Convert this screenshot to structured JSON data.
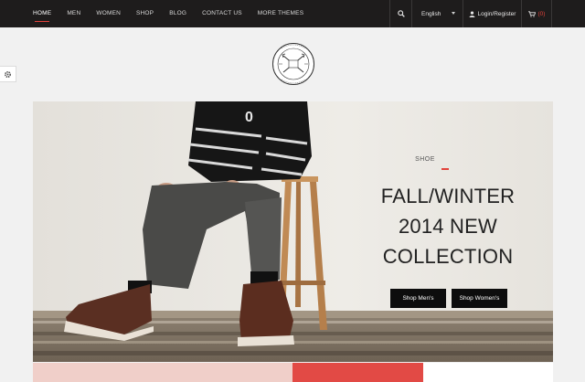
{
  "nav": {
    "items": [
      "HOME",
      "MEN",
      "WOMEN",
      "SHOP",
      "BLOG",
      "CONTACT US",
      "MORE THEMES"
    ],
    "active_index": 0
  },
  "toolbar": {
    "search_icon": "search-icon",
    "language": "English",
    "login_label": "Login/Register",
    "cart_count": "(0)"
  },
  "hero": {
    "kicker": "SHOE",
    "headline_lines": [
      "FALL/WINTER",
      "2014 NEW",
      "COLLECTION"
    ],
    "buttons": [
      "Shop Men's",
      "Shop Women's"
    ]
  },
  "colors": {
    "topbar": "#1e1c1c",
    "accent": "#e2423a",
    "button": "#0d0d0d"
  }
}
